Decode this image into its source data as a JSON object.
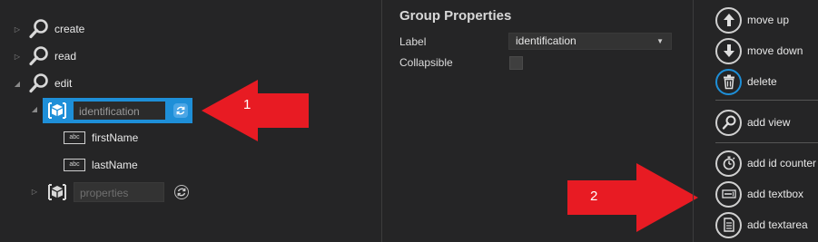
{
  "tree": {
    "items": [
      {
        "label": "create"
      },
      {
        "label": "read"
      },
      {
        "label": "edit"
      }
    ],
    "group_selected": {
      "input_value": "identification"
    },
    "children": [
      {
        "label": "firstName",
        "icon_text": "abc"
      },
      {
        "label": "lastName",
        "icon_text": "abc"
      }
    ],
    "group_other": {
      "input_value": "properties"
    }
  },
  "annotations": [
    {
      "number": "1",
      "color": "#e81b23"
    },
    {
      "number": "2",
      "color": "#e81b23"
    }
  ],
  "properties": {
    "title": "Group Properties",
    "label_caption": "Label",
    "label_value": "identification",
    "collapsible_caption": "Collapsible",
    "collapsible_checked": false
  },
  "actions": [
    {
      "label": "move up",
      "icon": "arrow-up-icon"
    },
    {
      "label": "move down",
      "icon": "arrow-down-icon"
    },
    {
      "label": "delete",
      "icon": "trash-icon"
    },
    {
      "label": "add view",
      "icon": "magnifier-icon"
    },
    {
      "label": "add id counter",
      "icon": "stopwatch-icon"
    },
    {
      "label": "add textbox",
      "icon": "textbox-icon"
    },
    {
      "label": "add textarea",
      "icon": "document-icon"
    }
  ],
  "colors": {
    "accent": "#1e8fd8",
    "background": "#252526",
    "annotation": "#e81b23"
  }
}
